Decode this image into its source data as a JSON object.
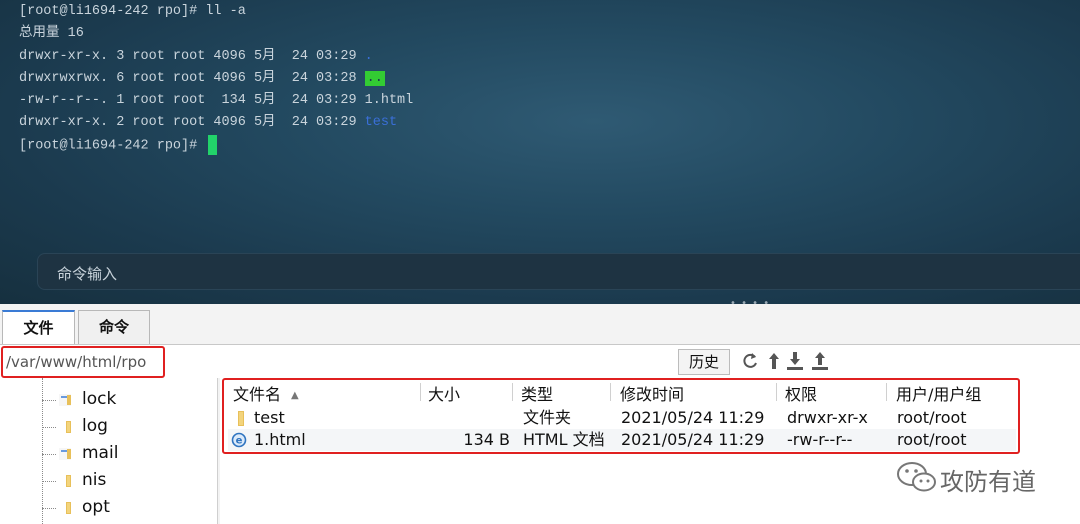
{
  "terminal": {
    "lines": [
      {
        "text": "[root@li1694-242 rpo]# ll -a"
      },
      {
        "text": "总用量 16"
      },
      {
        "text": "drwxr-xr-x. 3 root root 4096 5月  24 03:29 ",
        "name": "."
      },
      {
        "text": "drwxrwxrwx. 6 root root 4096 5月  24 03:28 ",
        "name": ".."
      },
      {
        "text": "-rw-r--r--. 1 root root  134 5月  24 03:29 ",
        "name": "1.html"
      },
      {
        "text": "drwxr-xr-x. 2 root root 4096 5月  24 03:29 ",
        "name": "test"
      },
      {
        "text": "[root@li1694-242 rpo]# "
      }
    ],
    "command_input_placeholder": "命令输入",
    "colors": {
      "dir": "#3a6fd8",
      "highlight": "#33cc33",
      "cursor": "#22d36a"
    }
  },
  "tabs": [
    {
      "label": "文件",
      "active": true
    },
    {
      "label": "命令",
      "active": false
    }
  ],
  "addressbar": {
    "path": "/var/www/html/rpo",
    "history_label": "历史",
    "icons": [
      "refresh-icon",
      "up-arrow-icon",
      "download-icon",
      "upload-icon"
    ]
  },
  "tree": {
    "items": [
      {
        "label": "lock",
        "icon": "link-folder-icon"
      },
      {
        "label": "log",
        "icon": "folder-icon"
      },
      {
        "label": "mail",
        "icon": "link-folder-icon"
      },
      {
        "label": "nis",
        "icon": "folder-icon"
      },
      {
        "label": "opt",
        "icon": "folder-icon"
      }
    ]
  },
  "file_list": {
    "headers": {
      "name": "文件名",
      "size": "大小",
      "type": "类型",
      "modified": "修改时间",
      "perms": "权限",
      "owner": "用户/用户组"
    },
    "rows": [
      {
        "name": "test",
        "size": "",
        "type": "文件夹",
        "modified": "2021/05/24 11:29",
        "perms": "drwxr-xr-x",
        "owner": "root/root",
        "icon": "folder-icon"
      },
      {
        "name": "1.html",
        "size": "134 B",
        "type": "HTML 文档",
        "modified": "2021/05/24 11:29",
        "perms": "-rw-r--r--",
        "owner": "root/root",
        "icon": "html-file-icon"
      }
    ]
  },
  "watermark": {
    "text": "攻防有道",
    "icon": "wechat-icon"
  }
}
